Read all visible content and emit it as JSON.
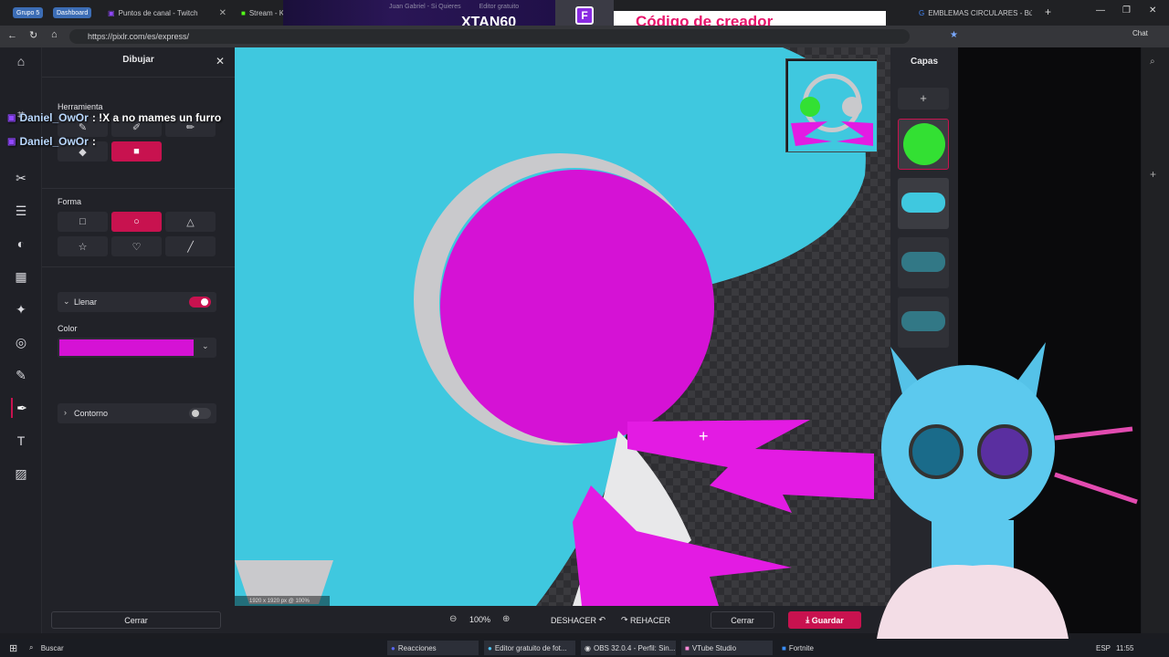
{
  "browser": {
    "tabs": [
      {
        "label": "Grupo 5"
      },
      {
        "label": "Dashboard"
      },
      {
        "label": "Puntos de canal - Twitch"
      },
      {
        "label": "Stream - Kick Dashboard"
      },
      {
        "label": "Juan Gabriel - Si Quieres"
      },
      {
        "label": "Editor gratuito"
      },
      {
        "label": "EMBLEMAS CIRCULARES - Bús"
      }
    ],
    "url": "https://pixlr.com/es/express/",
    "chat_label": "Chat"
  },
  "overlay": {
    "streamer": "XTAN60",
    "creator_code": "Código de creador",
    "chat_messages": [
      {
        "user": "Daniel_OwOr",
        "text": ": !X a no mames un furro"
      },
      {
        "user": "Daniel_OwOr",
        "text": ":"
      }
    ]
  },
  "panel": {
    "title": "Dibujar",
    "tool_section": "Herramienta",
    "shape_section": "Forma",
    "fill_label": "Llenar",
    "fill_on": true,
    "color_label": "Color",
    "color_value": "#d512d5",
    "outline_label": "Contorno",
    "outline_on": false,
    "close_button": "Cerrar"
  },
  "canvas": {
    "info": "1920 x 1920 px @ 100%"
  },
  "bottom_bar": {
    "zoom": "100%",
    "undo": "DESHACER",
    "redo": "REHACER",
    "cancel": "Cerrar",
    "save": "Guardar"
  },
  "layers": {
    "title": "Capas",
    "add": "+"
  },
  "taskbar": {
    "search": "Buscar",
    "apps": [
      {
        "label": "Reacciones"
      },
      {
        "label": "Editor gratuito de fot..."
      },
      {
        "label": "OBS 32.0.4 - Perfil: Sin..."
      },
      {
        "label": "VTube Studio"
      },
      {
        "label": "Fortnite"
      }
    ],
    "lang": "ESP",
    "time": "11:55"
  },
  "colors": {
    "accent": "#c8124f",
    "canvas_bg": "#3fc8df",
    "magenta": "#e31be3"
  }
}
